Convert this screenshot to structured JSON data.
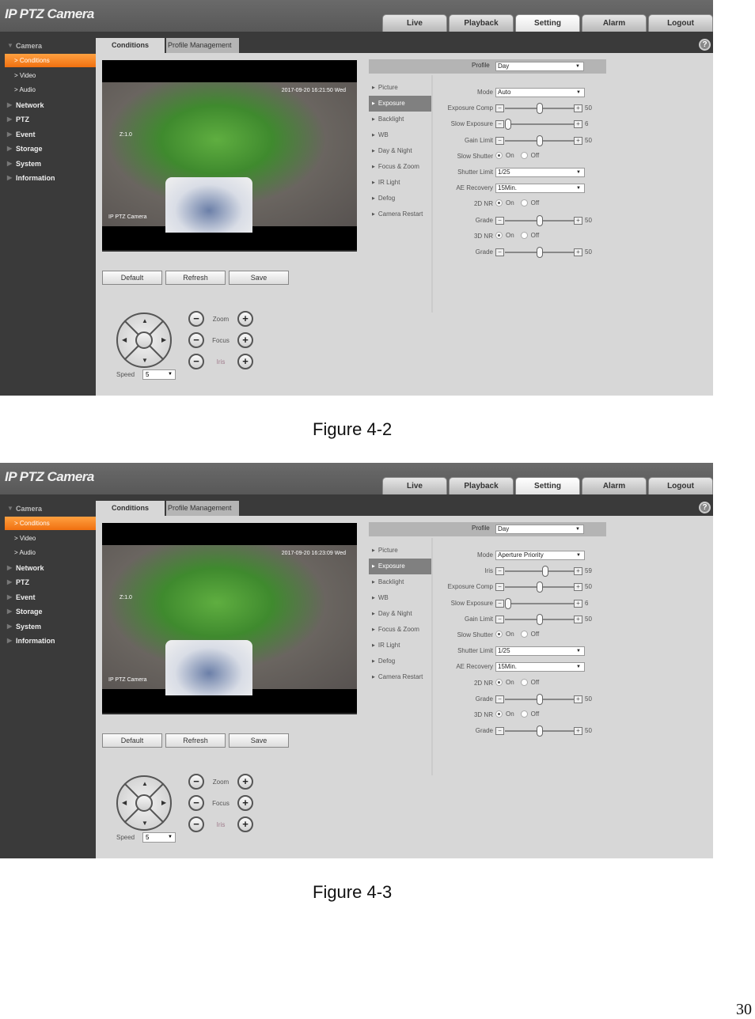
{
  "page_number": "30",
  "figures": [
    {
      "caption": "Figure 4-2",
      "app_title": "IP PTZ Camera",
      "nav_tabs": [
        "Live",
        "Playback",
        "Setting",
        "Alarm",
        "Logout"
      ],
      "active_nav_tab": "Setting",
      "sidebar": {
        "camera": "Camera",
        "sub_items": [
          "Conditions",
          "Video",
          "Audio"
        ],
        "active_sub": "Conditions",
        "items": [
          "Network",
          "PTZ",
          "Event",
          "Storage",
          "System",
          "Information"
        ]
      },
      "sub_tabs": [
        "Conditions",
        "Profile Management"
      ],
      "help_icon": "?",
      "video": {
        "timestamp": "2017-09-20 16:21:50 Wed",
        "zoom_osd": "Z:1.0",
        "channel_title": "IP PTZ Camera"
      },
      "buttons": [
        "Default",
        "Refresh",
        "Save"
      ],
      "ptz": {
        "speed_label": "Speed",
        "speed_value": "5",
        "lens": [
          "Zoom",
          "Focus",
          "Iris"
        ]
      },
      "profile": {
        "label": "Profile",
        "value": "Day"
      },
      "menu": [
        "Picture",
        "Exposure",
        "Backlight",
        "WB",
        "Day & Night",
        "Focus & Zoom",
        "IR Light",
        "Defog",
        "Camera Restart"
      ],
      "active_menu": "Exposure",
      "form": [
        {
          "type": "select",
          "label": "Mode",
          "value": "Auto"
        },
        {
          "type": "slider",
          "label": "Exposure Comp",
          "value": "50",
          "fraction": 0.5
        },
        {
          "type": "slider",
          "label": "Slow Exposure",
          "value": "6",
          "fraction": 0.05
        },
        {
          "type": "slider",
          "label": "Gain Limit",
          "value": "50",
          "fraction": 0.5
        },
        {
          "type": "radio",
          "label": "Slow Shutter",
          "on": "On",
          "off": "Off",
          "selected": "On"
        },
        {
          "type": "select",
          "label": "Shutter Limit",
          "value": "1/25"
        },
        {
          "type": "select",
          "label": "AE Recovery",
          "value": "15Min."
        },
        {
          "type": "radio",
          "label": "2D NR",
          "on": "On",
          "off": "Off",
          "selected": "On"
        },
        {
          "type": "slider",
          "label": "Grade",
          "value": "50",
          "fraction": 0.5
        },
        {
          "type": "radio",
          "label": "3D NR",
          "on": "On",
          "off": "Off",
          "selected": "On"
        },
        {
          "type": "slider",
          "label": "Grade",
          "value": "50",
          "fraction": 0.5
        }
      ]
    },
    {
      "caption": "Figure 4-3",
      "app_title": "IP PTZ Camera",
      "nav_tabs": [
        "Live",
        "Playback",
        "Setting",
        "Alarm",
        "Logout"
      ],
      "active_nav_tab": "Setting",
      "sidebar": {
        "camera": "Camera",
        "sub_items": [
          "Conditions",
          "Video",
          "Audio"
        ],
        "active_sub": "Conditions",
        "items": [
          "Network",
          "PTZ",
          "Event",
          "Storage",
          "System",
          "Information"
        ]
      },
      "sub_tabs": [
        "Conditions",
        "Profile Management"
      ],
      "help_icon": "?",
      "video": {
        "timestamp": "2017-09-20 16:23:09 Wed",
        "zoom_osd": "Z:1.0",
        "channel_title": "IP PTZ Camera"
      },
      "buttons": [
        "Default",
        "Refresh",
        "Save"
      ],
      "ptz": {
        "speed_label": "Speed",
        "speed_value": "5",
        "lens": [
          "Zoom",
          "Focus",
          "Iris"
        ]
      },
      "profile": {
        "label": "Profile",
        "value": "Day"
      },
      "menu": [
        "Picture",
        "Exposure",
        "Backlight",
        "WB",
        "Day & Night",
        "Focus & Zoom",
        "IR Light",
        "Defog",
        "Camera Restart"
      ],
      "active_menu": "Exposure",
      "form": [
        {
          "type": "select",
          "label": "Mode",
          "value": "Aperture Priority"
        },
        {
          "type": "slider",
          "label": "Iris",
          "value": "59",
          "fraction": 0.59
        },
        {
          "type": "slider",
          "label": "Exposure Comp",
          "value": "50",
          "fraction": 0.5
        },
        {
          "type": "slider",
          "label": "Slow Exposure",
          "value": "6",
          "fraction": 0.05
        },
        {
          "type": "slider",
          "label": "Gain Limit",
          "value": "50",
          "fraction": 0.5
        },
        {
          "type": "radio",
          "label": "Slow Shutter",
          "on": "On",
          "off": "Off",
          "selected": "On"
        },
        {
          "type": "select",
          "label": "Shutter Limit",
          "value": "1/25"
        },
        {
          "type": "select",
          "label": "AE Recovery",
          "value": "15Min."
        },
        {
          "type": "radio",
          "label": "2D NR",
          "on": "On",
          "off": "Off",
          "selected": "On"
        },
        {
          "type": "slider",
          "label": "Grade",
          "value": "50",
          "fraction": 0.5
        },
        {
          "type": "radio",
          "label": "3D NR",
          "on": "On",
          "off": "Off",
          "selected": "On"
        },
        {
          "type": "slider",
          "label": "Grade",
          "value": "50",
          "fraction": 0.5
        }
      ]
    }
  ]
}
